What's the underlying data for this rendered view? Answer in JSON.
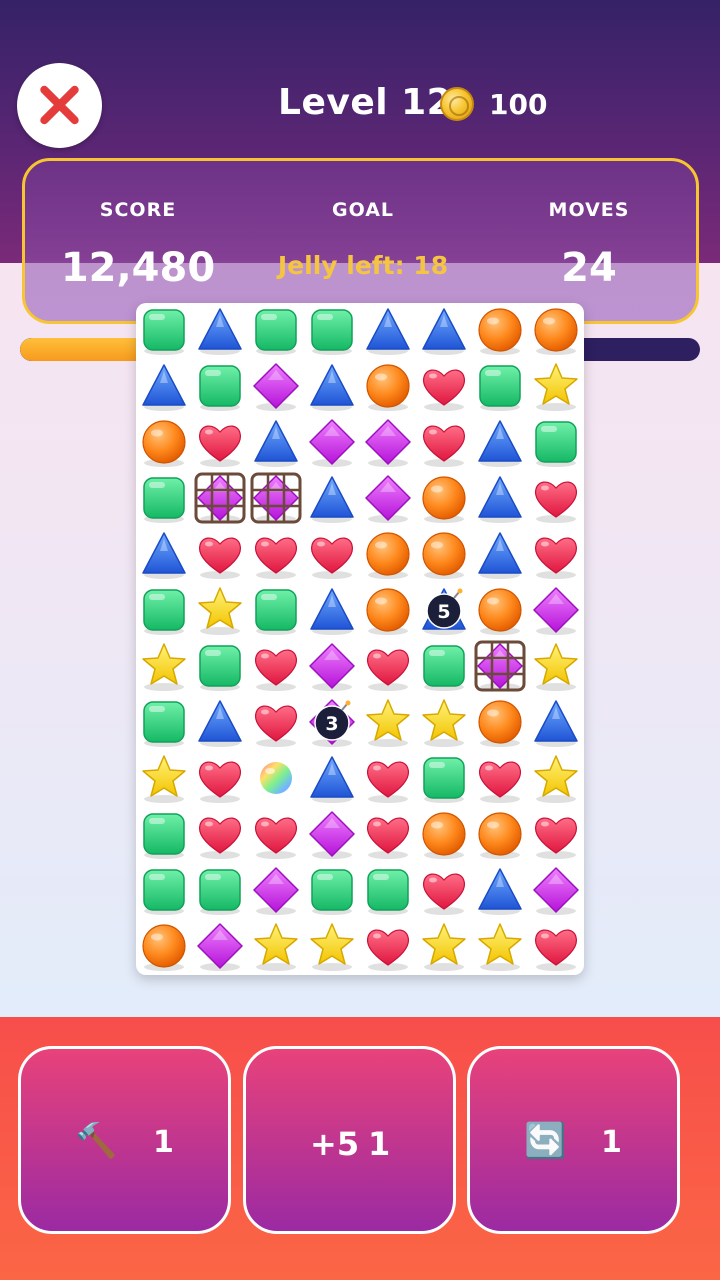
{
  "header": {
    "level_label": "Level 12",
    "coins": "100"
  },
  "stats": {
    "score_label": "SCORE",
    "score": "12,480",
    "goal_label": "GOAL",
    "goal": "Jelly left: 18",
    "moves_label": "MOVES",
    "moves": "24"
  },
  "progress": {
    "fraction": 0.37
  },
  "board": {
    "rows": 12,
    "cols": 8,
    "legend": {
      "G": "green-square",
      "B": "blue-triangle",
      "O": "orange-circle",
      "H": "red-heart",
      "P": "purple-diamond",
      "S": "yellow-star",
      "C": "caged-purple-diamond",
      "R": "rainbow-ball"
    },
    "grid": [
      "GBGGBBOO",
      "BGPBOHGS",
      "OHBPPHBG",
      "GCCBPOBH",
      "BHHHOOBH",
      "GSGBOBOP",
      "SGHPHGCS",
      "GBHPSSOB",
      "SHRBHGHS",
      "GHHPHOOH",
      "GGPGGHBP",
      "OPSSHSSH"
    ],
    "bombs": [
      {
        "row": 5,
        "col": 5,
        "count": "5"
      },
      {
        "row": 7,
        "col": 3,
        "count": "3"
      }
    ]
  },
  "boosters": {
    "hammer_icon": "hammer-icon",
    "hammer_glyph": "🔨",
    "hammer_count": "1",
    "plus_moves_label": "+5",
    "plus_moves_count": "1",
    "shuffle_icon": "shuffle-icon",
    "shuffle_glyph": "🔄",
    "shuffle_count": "1"
  }
}
